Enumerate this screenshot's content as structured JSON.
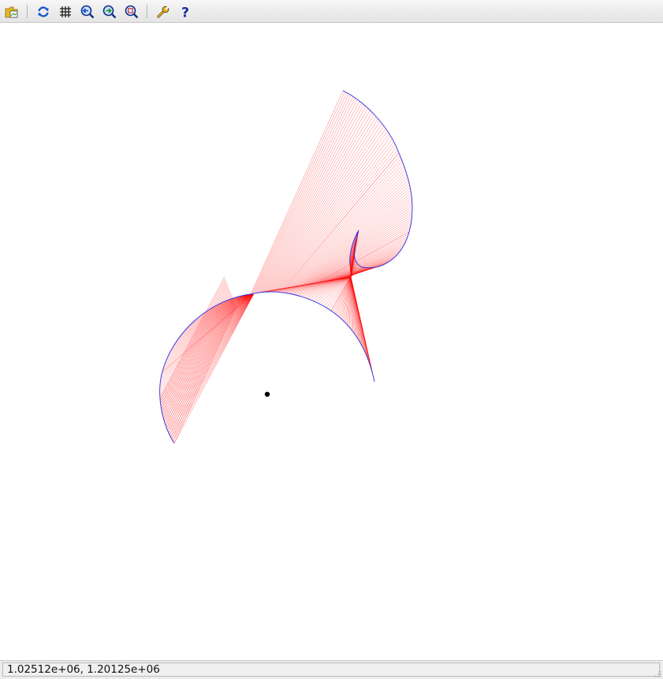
{
  "toolbar": {
    "buttons": [
      {
        "id": "open-file",
        "icon": "open-folder-icon",
        "tooltip": ""
      },
      {
        "id": "refresh",
        "icon": "refresh-icon",
        "tooltip": ""
      },
      {
        "id": "grid",
        "icon": "grid-icon",
        "tooltip": ""
      },
      {
        "id": "zoom-out",
        "icon": "zoom-out-icon",
        "tooltip": ""
      },
      {
        "id": "zoom-in",
        "icon": "zoom-in-icon",
        "tooltip": ""
      },
      {
        "id": "zoom-fit",
        "icon": "zoom-fit-icon",
        "tooltip": ""
      },
      {
        "id": "settings",
        "icon": "wrench-icon",
        "tooltip": ""
      },
      {
        "id": "help",
        "icon": "help-icon",
        "tooltip": ""
      }
    ]
  },
  "status": {
    "coordinates": "1.02512e+06,  1.20125e+06"
  },
  "colors": {
    "curve": "#2a2ae6",
    "chords": "#ff0000",
    "point": "#000000"
  }
}
